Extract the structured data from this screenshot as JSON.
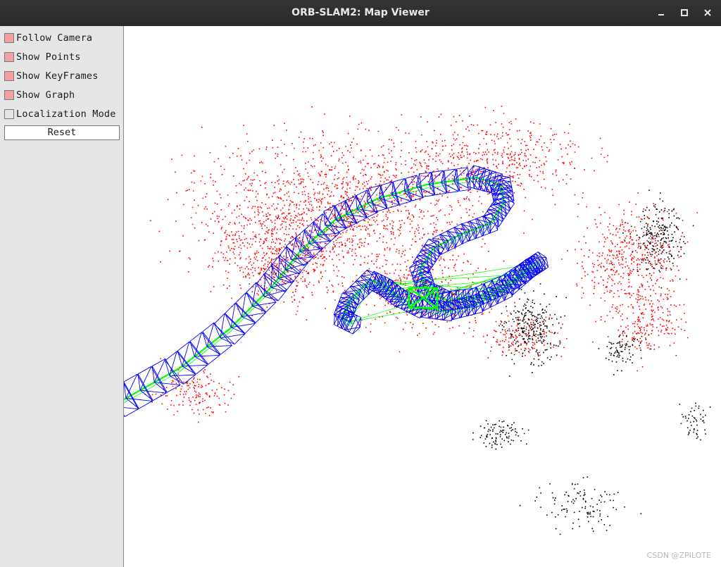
{
  "window": {
    "title": "ORB-SLAM2: Map Viewer"
  },
  "panel": {
    "options": [
      {
        "label": "Follow Camera",
        "checked": true
      },
      {
        "label": "Show Points",
        "checked": true
      },
      {
        "label": "Show KeyFrames",
        "checked": true
      },
      {
        "label": "Show Graph",
        "checked": true
      },
      {
        "label": "Localization Mode",
        "checked": false
      }
    ],
    "reset_label": "Reset"
  },
  "colors": {
    "checked_fill": "#f4a0a0",
    "unchecked_fill": "#e6e6e6",
    "map_points": "#ff0000",
    "reference_points": "#000000",
    "keyframes": "#0000ff",
    "graph": "#00ff00"
  },
  "watermark": "CSDN @ZPILOTE"
}
